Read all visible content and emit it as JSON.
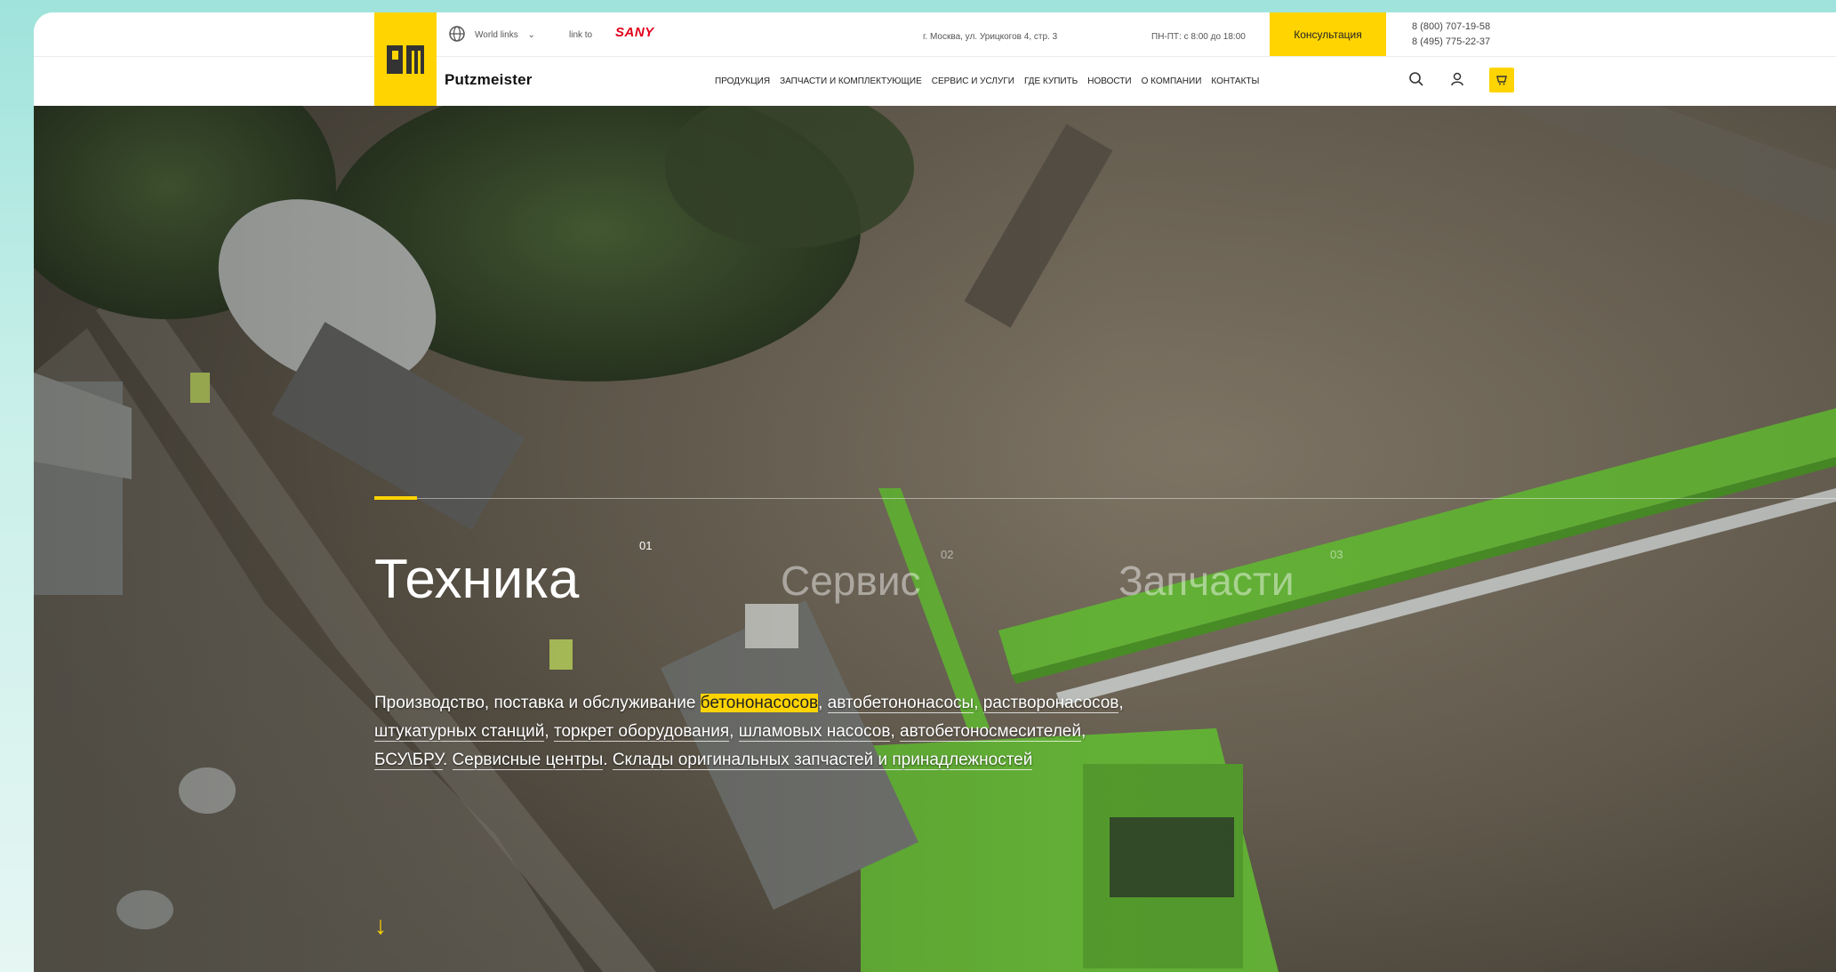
{
  "header": {
    "brand": "Putzmeister",
    "world_link": "World links",
    "sany_prefix": "link to",
    "sany_logo": "SANY",
    "address": "г. Москва, ул. Урицкогов 4, стр. 3",
    "hours": "ПН-ПТ: с 8:00 до 18:00",
    "consult_button": "Консультация",
    "phone_1": "8 (800) 707-19-58",
    "phone_2": "8 (495) 775-22-37",
    "nav": [
      "Продукция",
      "Запчасти и комплектующие",
      "Сервис и услуги",
      "Где купить",
      "Новости",
      "О компании",
      "Контакты"
    ],
    "icons": [
      "search-icon",
      "user-icon",
      "cart-icon"
    ],
    "accent_color": "#ffd400"
  },
  "hero": {
    "tabs": [
      {
        "number": "01",
        "title": "Техника",
        "active": true
      },
      {
        "number": "02",
        "title": "Сервис",
        "active": false
      },
      {
        "number": "03",
        "title": "Запчасти",
        "active": false
      }
    ],
    "desc": {
      "p1": "Производство, поставка и обслуживание ",
      "link1": "бетононасосов",
      "p2": ", ",
      "link2": "автобетононасосы",
      "p3": ", ",
      "link3": "растворонасосов",
      "p4": ", ",
      "link4": "штукатурных станций",
      "p5": ", ",
      "link5": "торкрет оборудования",
      "p6": ", ",
      "link6": "шламовых насосов",
      "p7": ", ",
      "link7": "автобетоносмесителей",
      "p8": ", ",
      "link8": "БСУ\\БРУ",
      "p9": ". ",
      "link9": "Сервисные центры",
      "p10": ". ",
      "link10": "Склады оригинальных запчастей и принадлежностей",
      "p11": ""
    },
    "scroll_arrow": "↓"
  }
}
